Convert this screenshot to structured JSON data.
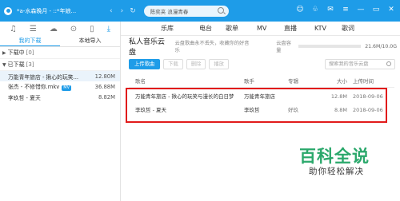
{
  "titlebar": {
    "now_playing": "*a-水森晚月 - ::*年娘...",
    "search_placeholder": "陈奕夹 浪漫青春"
  },
  "left_panel": {
    "tabs": [
      "我的下载",
      "本地导入"
    ],
    "downloading": {
      "label": "下载中",
      "count": "[0]"
    },
    "downloaded": {
      "label": "已下载",
      "count": "[3]"
    },
    "songs": [
      {
        "name": "万能青年旅店 - 揪心的玩笑...",
        "size": "12.80M"
      },
      {
        "name": "张杰 - 不修惜你.mkv",
        "badge": "MV",
        "size": "36.88M"
      },
      {
        "name": "李玖哲 - 夏天",
        "size": "8.82M"
      }
    ]
  },
  "topnav": [
    "乐库",
    "电台",
    "歌单",
    "MV",
    "直播",
    "KTV",
    "歌词"
  ],
  "cloud": {
    "title": "私人音乐云盘",
    "subtitle": "云盘歌曲永不丢失，收藏你的好音乐",
    "capacity_label": "云盘容量",
    "capacity_value": "21.6M/10.0G",
    "buttons": {
      "upload": "上传歌曲",
      "download": "下载",
      "delete": "删除",
      "play": "播放"
    },
    "search_placeholder": "搜索我的音乐云盘",
    "columns": {
      "name": "歌名",
      "singer": "歌手",
      "album": "专辑",
      "size": "大小",
      "time": "上传时间"
    },
    "rows": [
      {
        "name": "万能青年旅店 - 揪心的玩笑与漫长的白日梦",
        "singer": "万能青年旅店",
        "album": "",
        "size": "12.8M",
        "time": "2018-09-06"
      },
      {
        "name": "李玖哲 - 夏天",
        "singer": "李玖哲",
        "album": "好玖",
        "size": "8.8M",
        "time": "2018-09-06"
      }
    ]
  },
  "watermark": {
    "main": "百科全说",
    "sub": "助你轻松解决"
  }
}
